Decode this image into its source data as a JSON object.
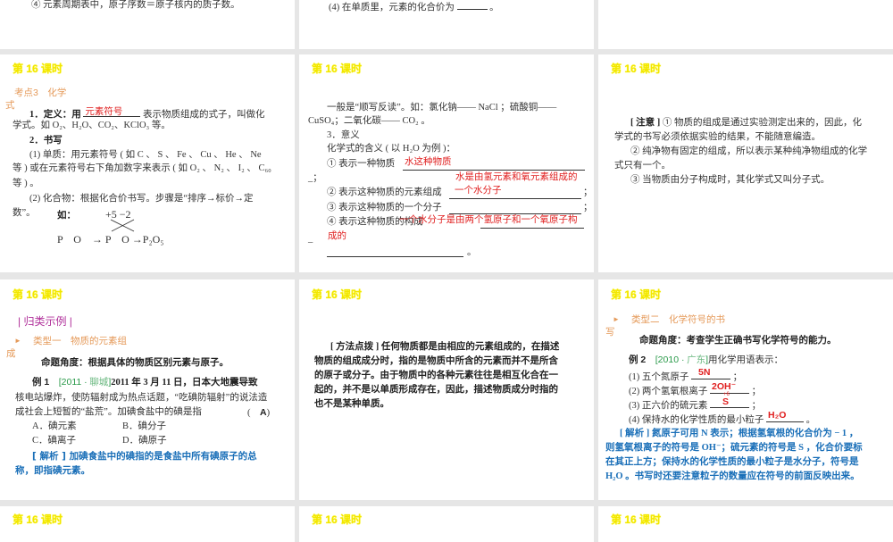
{
  "slides_top": {
    "s1_line": "④ 元素周期表中，原子序数＝原子核内的质子数。",
    "s2_line": "(4) 在单质里，元素的化合价为",
    "s2_end": "。"
  },
  "lesson_title": "第 16 课时",
  "slide_formula": {
    "heading": "考点3　化学",
    "heading_wrap": "式",
    "def_prefix": "1．定义：用",
    "def_answer": "元素符号",
    "def_suffix": "表示物质组成的式子，叫做化",
    "def_line2": "学式。如 O₂、H₂O、CO₂、KClO₃ 等。",
    "writing": "2．书写",
    "element_1": "(1) 单质：用元素符号 ( 如 C 、 S 、 Fe 、 Cu 、 He 、 Ne",
    "element_2": "等 ) 或在元素符号右下角加数字来表示 ( 如 O₂ 、 N₂ 、 I₂ 、 C₆₀",
    "element_3": "等 ) 。",
    "compound_1": "(2) 化合物：根据化合价书写。步骤是“排序→标价→定",
    "compound_2": "数”。",
    "example_label": "如：",
    "valence": "+5 −2",
    "formula_steps": "P　O　→ P　O →P₂O₅"
  },
  "slide_meaning": {
    "intro_1": "一般是“顺写反读”。如：氯化钠—— NaCl ；硫酸铜——",
    "intro_2": "CuSO₄；二氧化碳—— CO₂ 。",
    "heading": "3．意义",
    "meaning_intro": "化学式的含义 ( 以 H₂O 为例 )：",
    "item1": "① 表示一种物质",
    "item1_answer": "水这种物质",
    "item1_end": "_；",
    "item2": "② 表示这种物质的元素组成",
    "item2_answer": "水是由氢元素和氧元素组成的",
    "item3": "③ 表示这种物质的一个分子",
    "item3_answer": "一个水分子",
    "item4": "④ 表示这种物质的构成",
    "item4_answer": "一个水分子是由两个氢原子和一个氧原子构",
    "item4_answer_2": "成的",
    "semicolon": "；",
    "dash": "_",
    "period": "。"
  },
  "slide_note": {
    "label": "[ 注意 ]",
    "line1": "① 物质的组成是通过实验测定出来的，因此，化",
    "line2": "学式的书写必须依据实验的结果，不能随意编造。",
    "line3": "② 纯净物有固定的组成，所以表示某种纯净物组成的化学",
    "line4": "式只有一个。",
    "line5": "③ 当物质由分子构成时，其化学式又叫分子式。"
  },
  "slide_example1": {
    "section": "| 归类示例 |",
    "type_heading": "类型一　物质的元素组",
    "type_heading_wrap": "成",
    "angle": "命题角度：根据具体的物质区别元素与原子。",
    "example_label": "例 1",
    "source_year": "[2011 ·",
    "source_place": "聊城",
    "source_close": "]",
    "q1": "2011 年 3 月 11 日，日本大地震导致",
    "q2": "核电站爆炸，使防辐射成为热点话题，“吃碘防辐射”的说法造",
    "q3": "成社会上短暂的“盐荒”。加碘食盐中的碘是指",
    "paren_open": "(",
    "answer": "A",
    "paren_close": ")",
    "options": [
      "A．碘元素",
      "B．碘分子",
      "C．碘离子",
      "D．碘原子"
    ],
    "analysis_1": "[ 解析 ] 加碘食盐中的碘指的是食盐中所有碘原子的总",
    "analysis_2": "称，即指碘元素。"
  },
  "slide_method": {
    "label": "[ 方法点拨 ]",
    "line1": "任何物质都是由相应的元素组成的，在描述",
    "line2": "物质的组成成分时，指的是物质中所含的元素而并不是所含",
    "line3": "的原子或分子。由于物质中的各种元素往往是相互化合在一",
    "line4": "起的，并不是以单质形成存在，因此，描述物质成分时指的",
    "line5": "也不是某种单质。"
  },
  "slide_example2": {
    "type_heading": "类型二　化学符号的书",
    "type_heading_wrap": "写",
    "angle": "命题角度：考查学生正确书写化学符号的能力。",
    "example_label": "例 2",
    "source_year": "[2010 ·",
    "source_place": "广东",
    "source_close": "]",
    "prompt": "用化学用语表示：",
    "items": [
      {
        "q": "(1) 五个氮原子",
        "a": "5N",
        "end": "；"
      },
      {
        "q": "(2) 两个氢氧根离子",
        "a": "2OH⁻",
        "end": "；"
      },
      {
        "q": "(3) 正六价的硫元素",
        "a": "S",
        "sup": "+6",
        "end": "；"
      },
      {
        "q": "(4) 保持水的化学性质的最小粒子",
        "a": "H₂O",
        "end": "。"
      }
    ],
    "analysis_1": "[ 解析 ] 氮原子可用 N 表示；根据氢氧根的化合价为 − 1 ，",
    "analysis_2": "则氢氧根离子的符号是 OH⁻；硫元素的符号是 S ，化合价要标",
    "analysis_3": "在其正上方；保持水的化学性质的最小粒子是水分子，符号是",
    "analysis_4": "H₂O 。书写时还要注意粒子的数量应在符号的前面反映出来。"
  },
  "colors": {
    "title": "#f2e600",
    "answer": "#e02020",
    "analysis": "#1a6fb8",
    "heading": "#e59a5a",
    "section": "#b0309a",
    "source": "#2a9a4a"
  }
}
